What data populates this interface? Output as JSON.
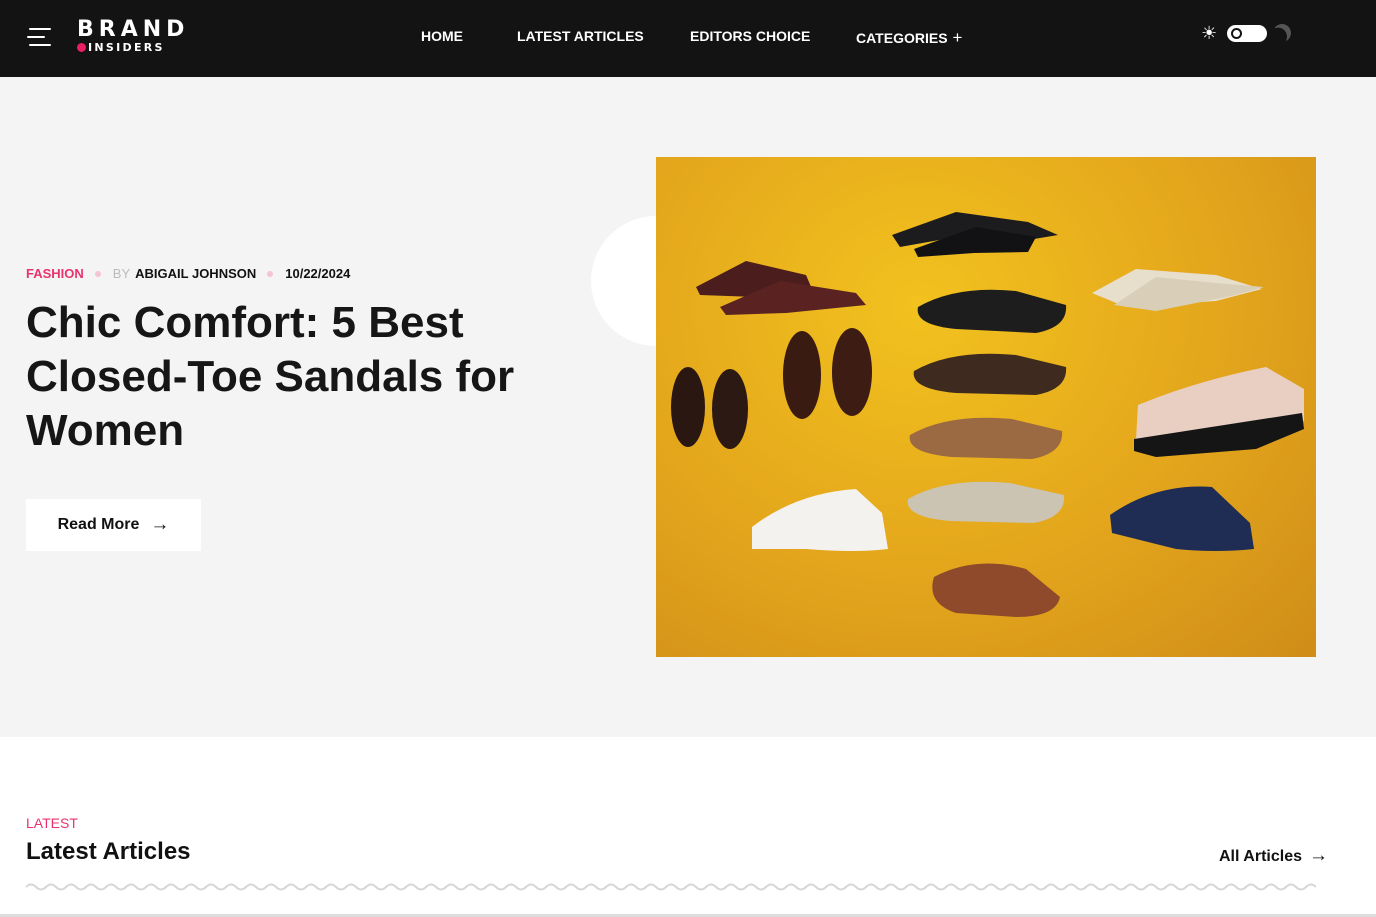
{
  "header": {
    "logo": {
      "line1": "BRAND",
      "line2": "INSIDERS"
    },
    "nav": [
      {
        "label": "HOME"
      },
      {
        "label": "LATEST ARTICLES"
      },
      {
        "label": "EDITORS CHOICE"
      },
      {
        "label": "CATEGORIES",
        "icon": "plus-icon"
      }
    ],
    "theme_toggle": {
      "mode": "light",
      "icons": [
        "sun-icon",
        "moon-icon"
      ]
    }
  },
  "hero": {
    "category": "FASHION",
    "by_label": "BY",
    "author": "ABIGAIL JOHNSON",
    "date": "10/22/2024",
    "title": "Chic Comfort: 5 Best Closed-Toe Sandals for Women",
    "cta_label": "Read More",
    "cta_icon": "arrow-right-icon",
    "image_subject": "collage of closed-toe sandals on a yellow textured background"
  },
  "latest": {
    "eyebrow": "LATEST",
    "title": "Latest Articles",
    "all_link": "All Articles",
    "all_link_icon": "arrow-right-icon"
  },
  "colors": {
    "header_bg": "#131313",
    "accent": "#e8336d",
    "hero_bg": "#f4f4f4",
    "image_bg": "#e3a51c"
  }
}
